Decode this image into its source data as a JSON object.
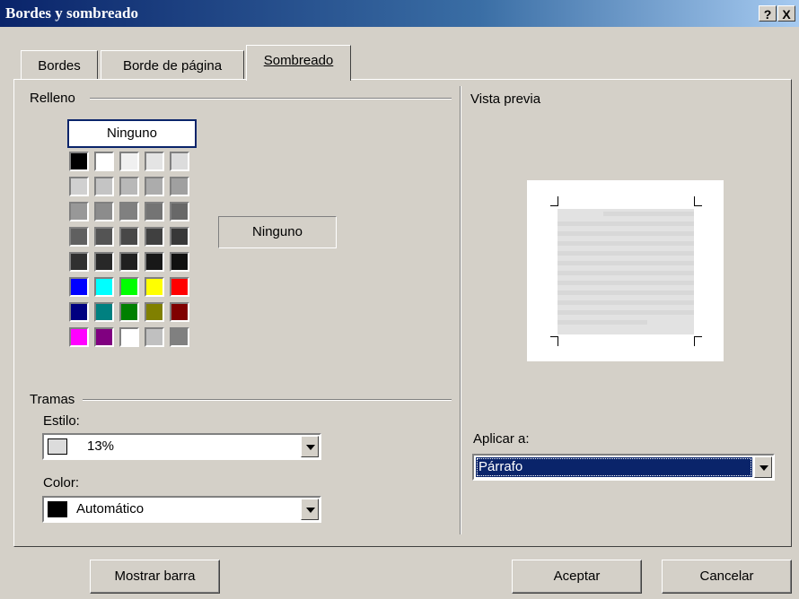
{
  "window": {
    "title": "Bordes y sombreado",
    "help_label": "?",
    "close_label": "X"
  },
  "tabs": [
    {
      "label": "Bordes"
    },
    {
      "label": "Borde de página"
    },
    {
      "label": "Sombreado"
    }
  ],
  "fill": {
    "group_label": "Relleno",
    "none_button": "Ninguno",
    "selected_label": "Ninguno",
    "palette": [
      [
        "#000000",
        "#ffffff",
        "#f0f0f0",
        "#e4e4e4",
        "#dcdcdc"
      ],
      [
        "#d0d0d0",
        "#c4c4c4",
        "#b8b8b8",
        "#acacac",
        "#a0a0a0"
      ],
      [
        "#989898",
        "#8c8c8c",
        "#808080",
        "#747474",
        "#686868"
      ],
      [
        "#606060",
        "#545454",
        "#484848",
        "#404040",
        "#383838"
      ],
      [
        "#303030",
        "#282828",
        "#202020",
        "#181818",
        "#101010"
      ],
      [
        "#0000ff",
        "#00ffff",
        "#00ff00",
        "#ffff00",
        "#ff0000"
      ],
      [
        "#000080",
        "#008080",
        "#008000",
        "#808000",
        "#800000"
      ],
      [
        "#ff00ff",
        "#800080",
        "#ffffff",
        "#c0c0c0",
        "#808080"
      ]
    ]
  },
  "patterns": {
    "group_label": "Tramas",
    "style_label": "Estilo:",
    "style_value": "13%",
    "style_swatch": "#dcdcdc",
    "color_label": "Color:",
    "color_value": "Automático",
    "color_swatch": "#000000"
  },
  "preview": {
    "label": "Vista previa"
  },
  "apply": {
    "label": "Aplicar a:",
    "value": "Párrafo"
  },
  "buttons": {
    "toolbar": "Mostrar barra",
    "ok": "Aceptar",
    "cancel": "Cancelar"
  },
  "colors": {
    "title_start": "#0a246a",
    "title_end": "#a6caf0",
    "selection": "#0a246a",
    "face": "#d4d0c8"
  }
}
